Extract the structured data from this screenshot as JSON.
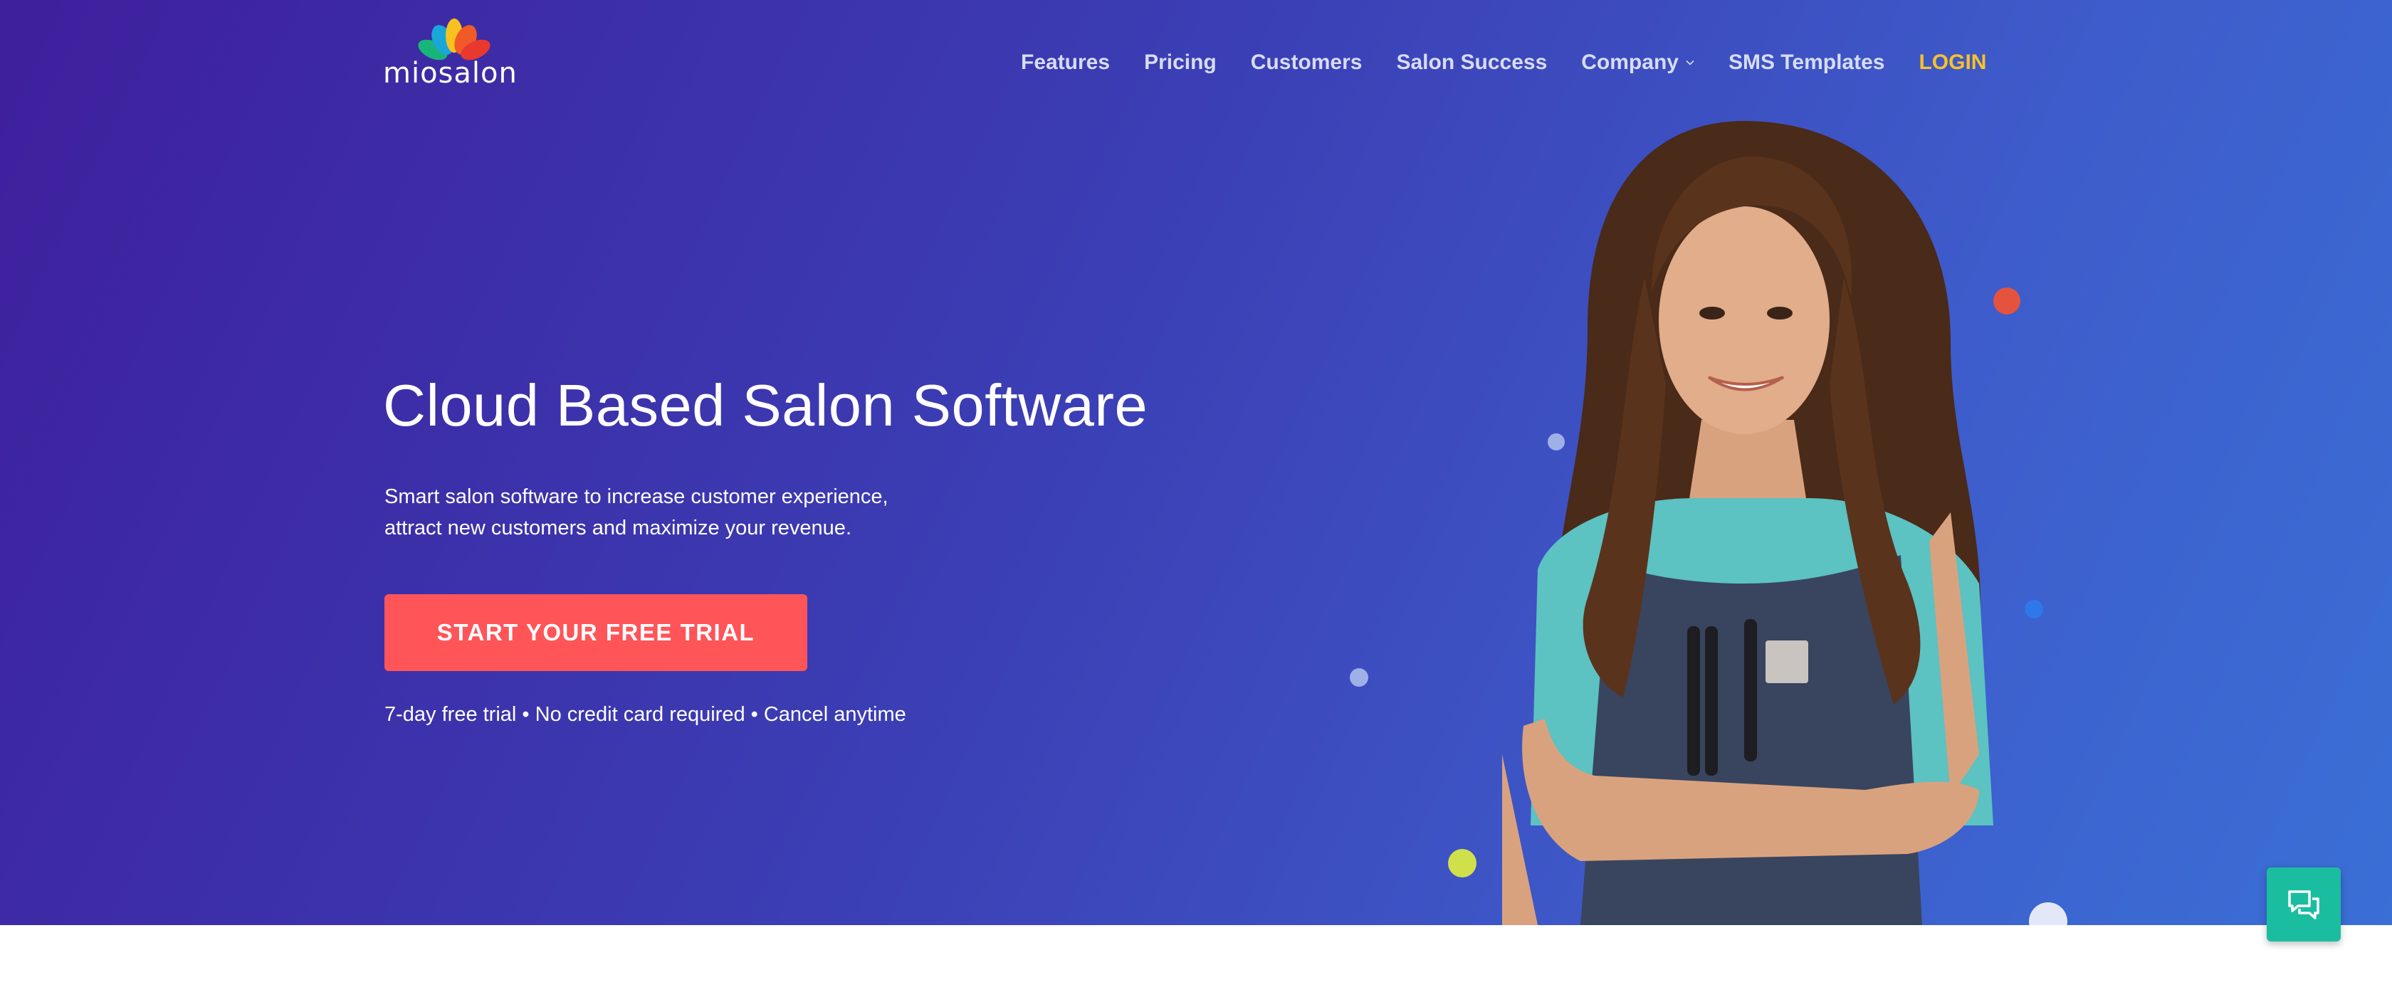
{
  "brand": {
    "name": "miosalon"
  },
  "nav": {
    "features": "Features",
    "pricing": "Pricing",
    "customers": "Customers",
    "salon_success": "Salon Success",
    "company": "Company",
    "sms_templates": "SMS Templates",
    "login": "LOGIN"
  },
  "hero": {
    "headline": "Cloud Based Salon Software",
    "sub_line1": "Smart salon software to increase customer experience,",
    "sub_line2": "attract new customers and maximize your revenue.",
    "cta": "START YOUR FREE TRIAL",
    "note": "7-day free trial • No credit card required • Cancel anytime"
  },
  "icons": {
    "company_dropdown": "chevron-down-icon",
    "chat": "chat-icon",
    "logo": "lotus-logo-icon"
  },
  "colors": {
    "hero_start": "#3e1f9c",
    "hero_end": "#3a6fd6",
    "cta": "#ff5458",
    "login": "#f6c22a",
    "chat": "#1bbda0"
  }
}
